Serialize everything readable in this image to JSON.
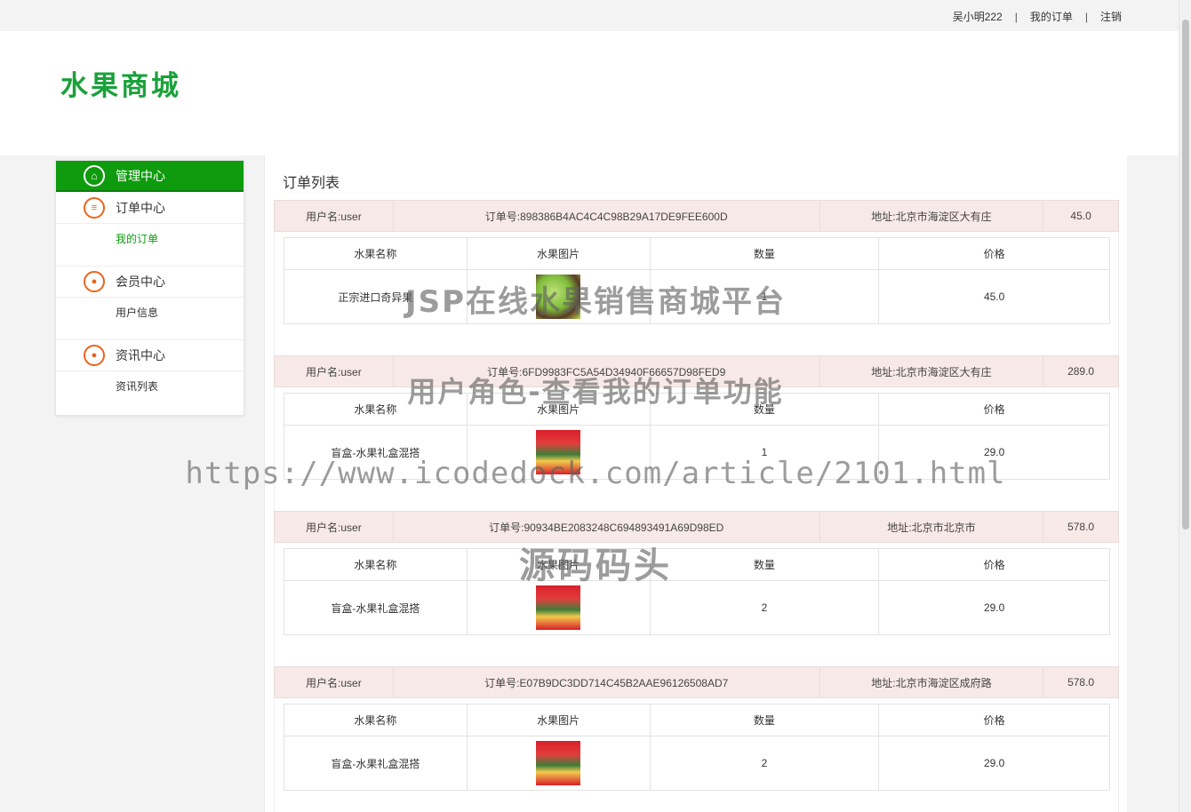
{
  "topbar": {
    "username": "吴小明222",
    "sep": "|",
    "my_orders": "我的订单",
    "logout": "注销"
  },
  "header": {
    "logo": "水果商城"
  },
  "sidebar": {
    "head": {
      "label": "管理中心",
      "icon": "home-icon"
    },
    "sections": [
      {
        "title": "订单中心",
        "icon": "document-icon",
        "items": [
          "我的订单"
        ],
        "active": true
      },
      {
        "title": "会员中心",
        "icon": "user-icon",
        "items": [
          "用户信息"
        ]
      },
      {
        "title": "资讯中心",
        "icon": "user-icon",
        "items": [
          "资讯列表"
        ]
      }
    ]
  },
  "main": {
    "title": "订单列表"
  },
  "table_headers": {
    "name": "水果名称",
    "image": "水果图片",
    "qty": "数量",
    "price": "价格"
  },
  "orders": [
    {
      "user": "用户名:user",
      "order_no": "订单号:898386B4AC4C4C98B29A17DE9FEE600D",
      "address": "地址:北京市海淀区大有庄",
      "total": "45.0",
      "item": {
        "name": "正宗进口奇异果",
        "qty": "1",
        "price": "45.0",
        "image": "kiwi-image"
      }
    },
    {
      "user": "用户名:user",
      "order_no": "订单号:6FD9983FC5A54D34940F66657D98FED9",
      "address": "地址:北京市海淀区大有庄",
      "total": "289.0",
      "item": {
        "name": "盲盒-水果礼盒混搭",
        "qty": "1",
        "price": "29.0",
        "image": "gift-box-image"
      }
    },
    {
      "user": "用户名:user",
      "order_no": "订单号:90934BE2083248C694893491A69D98ED",
      "address": "地址:北京市北京市",
      "total": "578.0",
      "item": {
        "name": "盲盒-水果礼盒混搭",
        "qty": "2",
        "price": "29.0",
        "image": "gift-box-image"
      }
    },
    {
      "user": "用户名:user",
      "order_no": "订单号:E07B9DC3DD714C45B2AAE96126508AD7",
      "address": "地址:北京市海淀区成府路",
      "total": "578.0",
      "item": {
        "name": "盲盒-水果礼盒混搭",
        "qty": "2",
        "price": "29.0",
        "image": "gift-box-image"
      }
    }
  ],
  "watermarks": {
    "line1": "JSP在线水果销售商城平台",
    "line2": "用户角色-查看我的订单功能",
    "line3": "https://www.icodedock.com/article/2101.html",
    "line4": "源码码头"
  },
  "colors": {
    "brand_green": "#0e9b0e",
    "logo_green": "#1aa13a",
    "icon_orange": "#e8641c",
    "order_head_bg": "#f7e9e7"
  }
}
